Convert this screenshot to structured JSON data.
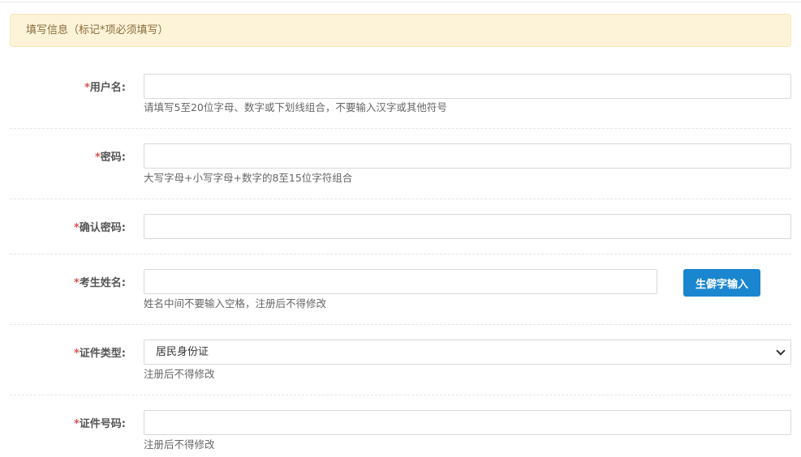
{
  "notice": {
    "text": "填写信息（标记*项必须填写）"
  },
  "required_mark": "*",
  "fields": {
    "username": {
      "label": "用户名:",
      "value": "",
      "hint": "请填写5至20位字母、数字或下划线组合，不要输入汉字或其他符号"
    },
    "password": {
      "label": "密码:",
      "value": "",
      "hint": "大写字母+小写字母+数字的8至15位字符组合"
    },
    "confirm_password": {
      "label": "确认密码:",
      "value": ""
    },
    "name": {
      "label": "考生姓名:",
      "value": "",
      "hint": "姓名中间不要输入空格，注册后不得修改",
      "button": "生僻字输入"
    },
    "id_type": {
      "label": "证件类型:",
      "selected": "居民身份证",
      "hint": "注册后不得修改"
    },
    "id_number": {
      "label": "证件号码:",
      "value": "",
      "hint": "注册后不得修改"
    }
  },
  "colors": {
    "accent": "#1a86cf",
    "notice_bg": "#fcf3d9",
    "notice_text": "#8a6d3b",
    "required": "#d9534f"
  }
}
